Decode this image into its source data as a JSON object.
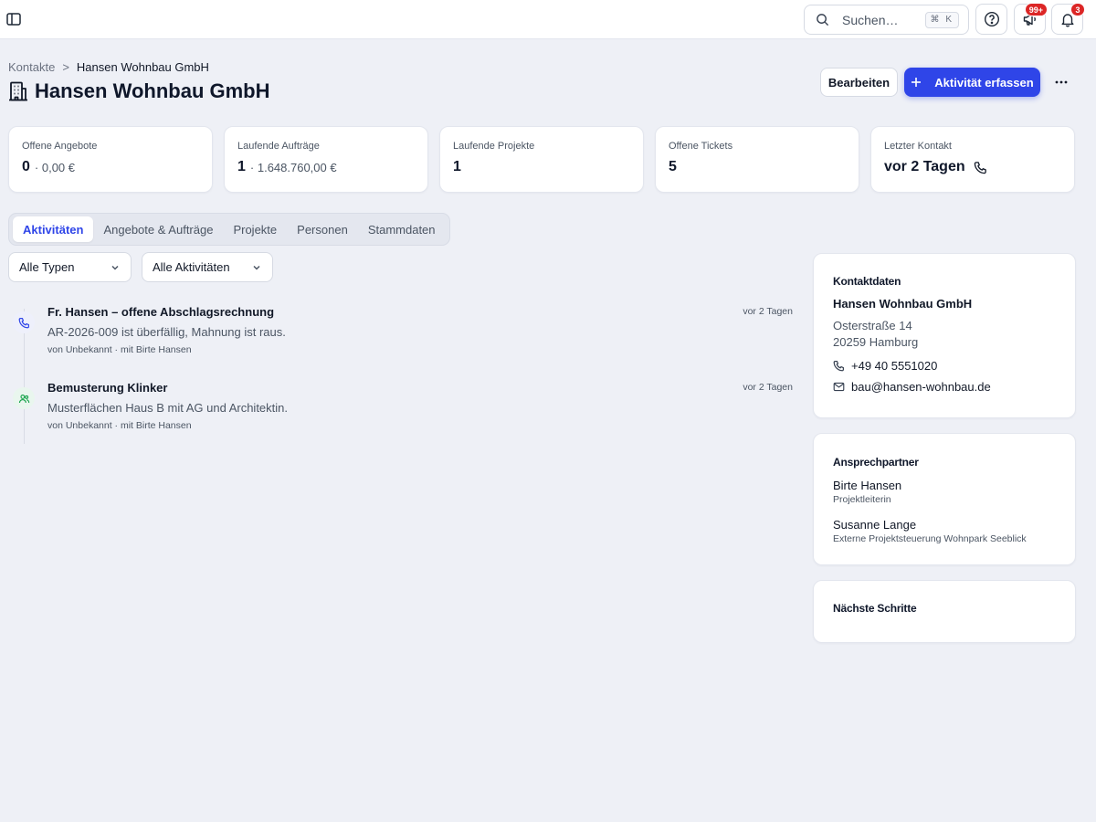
{
  "topbar": {
    "search_placeholder": "Suchen…",
    "search_shortcut": "⌘ K",
    "announcements_badge": "99+",
    "notifications_badge": "3"
  },
  "breadcrumb": {
    "parent": "Kontakte",
    "separator": ">",
    "current": "Hansen Wohnbau GmbH"
  },
  "page": {
    "title": "Hansen Wohnbau GmbH",
    "edit_label": "Bearbeiten",
    "primary_label": "Aktivität erfassen"
  },
  "stats": [
    {
      "label": "Offene Angebote",
      "value": "0",
      "sub": "· 0,00 €"
    },
    {
      "label": "Laufende Aufträge",
      "value": "1",
      "sub": "· 1.648.760,00 €"
    },
    {
      "label": "Laufende Projekte",
      "value": "1",
      "sub": ""
    },
    {
      "label": "Offene Tickets",
      "value": "5",
      "sub": ""
    },
    {
      "label": "Letzter Kontakt",
      "value": "vor 2 Tagen",
      "sub": ""
    }
  ],
  "tabs": [
    {
      "label": "Aktivitäten",
      "active": true
    },
    {
      "label": "Angebote & Aufträge"
    },
    {
      "label": "Projekte"
    },
    {
      "label": "Personen"
    },
    {
      "label": "Stammdaten"
    }
  ],
  "filters": {
    "type": "Alle Typen",
    "scope": "Alle Aktivitäten"
  },
  "activities": [
    {
      "icon": "phone-icon",
      "title": "Fr. Hansen – offene Abschlagsrechnung",
      "time": "vor 2 Tagen",
      "description": "AR-2026-009 ist überfällig, Mahnung ist raus.",
      "meta": "von Unbekannt · mit Birte Hansen"
    },
    {
      "icon": "users-icon",
      "title": "Bemusterung Klinker",
      "time": "vor 2 Tagen",
      "description": "Musterflächen Haus B mit AG und Architektin.",
      "meta": "von Unbekannt · mit Birte Hansen"
    }
  ],
  "contact_card": {
    "title": "Kontaktdaten",
    "company": "Hansen Wohnbau GmbH",
    "street": "Osterstraße 14",
    "city": "20259 Hamburg",
    "phone": "+49 40 5551020",
    "email": "bau@hansen-wohnbau.de"
  },
  "persons_card": {
    "title": "Ansprechpartner",
    "persons": [
      {
        "name": "Birte Hansen",
        "role": "Projektleiterin"
      },
      {
        "name": "Susanne Lange",
        "role": "Externe Projektsteuerung Wohnpark Seeblick"
      }
    ]
  },
  "next_steps_card": {
    "title": "Nächste Schritte"
  },
  "colors": {
    "accent": "#2f45e8",
    "badge": "#dc2626",
    "background": "#eef0f6"
  }
}
